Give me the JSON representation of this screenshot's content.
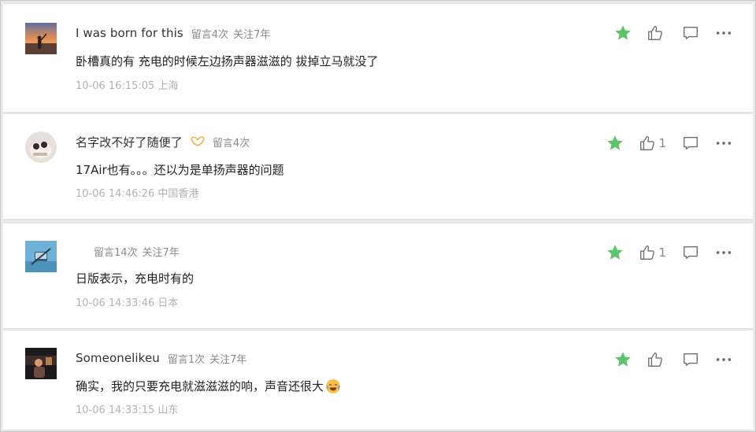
{
  "comments": [
    {
      "name": "I was born for this",
      "stats": [
        "留言4次",
        "关注7年"
      ],
      "text": "卧槽真的有 充电的时候左边扬声器滋滋的 拔掉立马就没了",
      "time": "10-06 16:15:05 上海",
      "likes": ""
    },
    {
      "name": "名字改不好了随便了",
      "stats": [
        "留言4次"
      ],
      "text": "17Air也有。。。还以为是单扬声器的问题",
      "time": "10-06 14:46:26 中国香港",
      "likes": "1"
    },
    {
      "name": "",
      "stats": [
        "留言14次",
        "关注7年"
      ],
      "text": "日版表示，充电时有的",
      "time": "10-06 14:33:46 日本",
      "likes": "1"
    },
    {
      "name": "Someonelikeu",
      "stats": [
        "留言1次",
        "关注7年"
      ],
      "text": "确实，我的只要充电就滋滋滋的响，声音还很大",
      "time": "10-06 14:33:15 山东",
      "likes": ""
    }
  ],
  "icons": {
    "star": "star-icon",
    "like": "thumbs-up-icon",
    "reply": "comment-icon",
    "more": "more-dots-icon",
    "badge": "butterfly-icon",
    "emoji": "laughing-crying-emoji"
  },
  "colors": {
    "star": "#5cc46a",
    "icon": "#6f6f6f",
    "badge": "#f0a93a"
  }
}
